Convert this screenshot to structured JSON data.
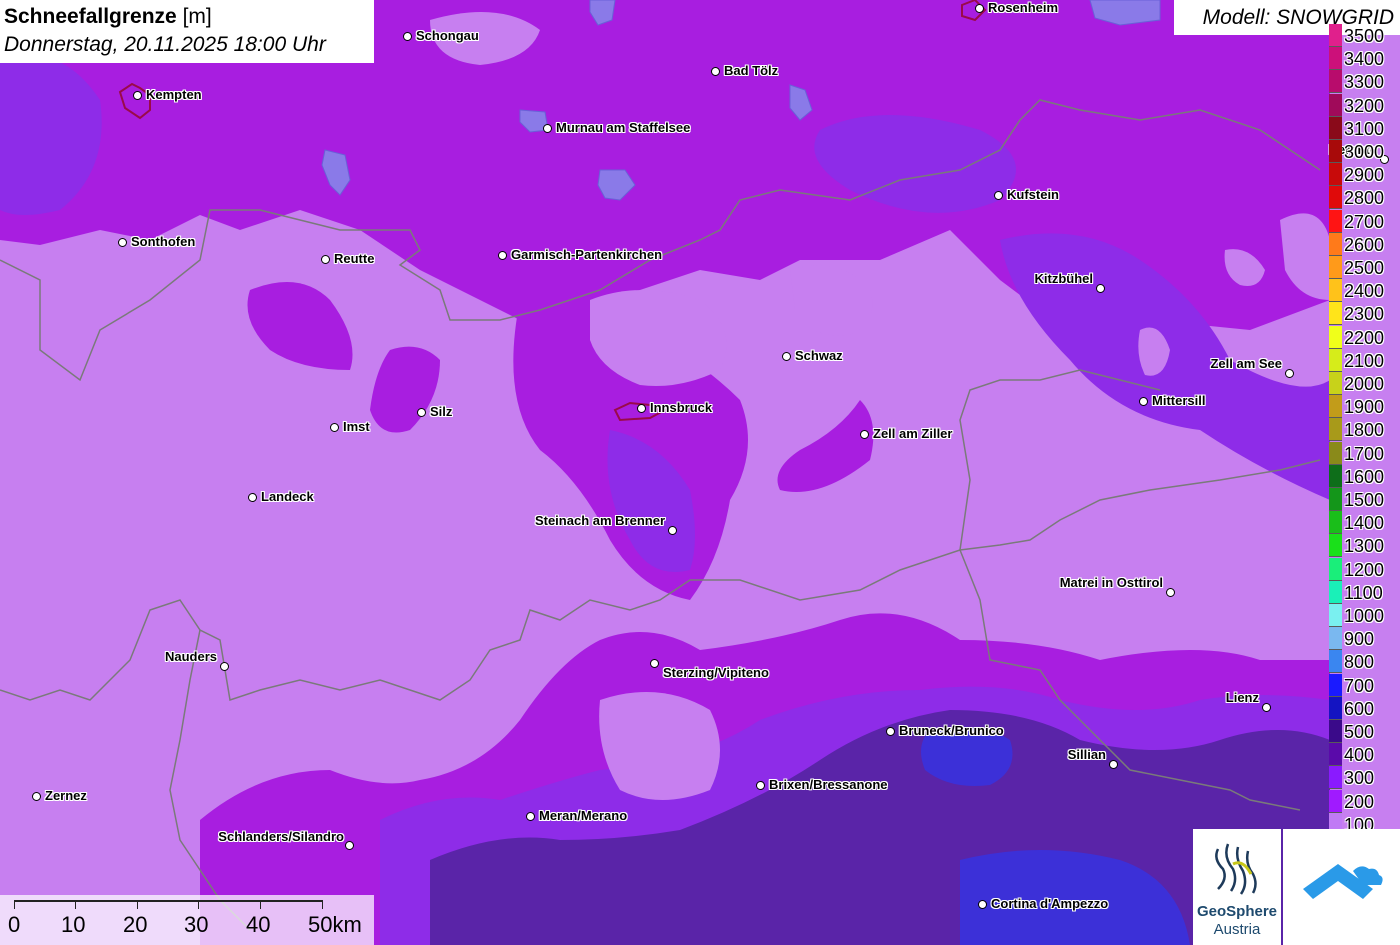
{
  "title": {
    "bold": "Schneefallgrenze",
    "unit": "[m]",
    "datetime": "Donnerstag, 20.11.2025 18:00 Uhr"
  },
  "model_label": "Modell: SNOWGRID",
  "cities": [
    {
      "name": "Rosenheim"
    },
    {
      "name": "Schongau"
    },
    {
      "name": "Bad Tölz"
    },
    {
      "name": "Kempten"
    },
    {
      "name": "Murnau am Staffelsee"
    },
    {
      "name": "Berchte"
    },
    {
      "name": "Kufstein"
    },
    {
      "name": "Sonthofen"
    },
    {
      "name": "Reutte"
    },
    {
      "name": "Garmisch-Partenkirchen"
    },
    {
      "name": "Kitzbühel"
    },
    {
      "name": "Schwaz"
    },
    {
      "name": "Zell am See"
    },
    {
      "name": "Mittersill"
    },
    {
      "name": "Innsbruck"
    },
    {
      "name": "Silz"
    },
    {
      "name": "Imst"
    },
    {
      "name": "Zell am Ziller"
    },
    {
      "name": "Landeck"
    },
    {
      "name": "Steinach am Brenner"
    },
    {
      "name": "Matrei in Osttirol"
    },
    {
      "name": "Nauders"
    },
    {
      "name": "Sterzing/Vipiteno"
    },
    {
      "name": "Lienz"
    },
    {
      "name": "Bruneck/Brunico"
    },
    {
      "name": "Sillian"
    },
    {
      "name": "Brixen/Bressanone"
    },
    {
      "name": "Zernez"
    },
    {
      "name": "Meran/Merano"
    },
    {
      "name": "Schlanders/Silandro"
    },
    {
      "name": "Cortina d'Ampezzo"
    }
  ],
  "legend": [
    {
      "value": "3500",
      "color": "#e0208c"
    },
    {
      "value": "3400",
      "color": "#cc107a"
    },
    {
      "value": "3300",
      "color": "#b80c6c"
    },
    {
      "value": "3200",
      "color": "#a00a5a"
    },
    {
      "value": "3100",
      "color": "#8a0a1a"
    },
    {
      "value": "3000",
      "color": "#a80a0a"
    },
    {
      "value": "2900",
      "color": "#c80a0a"
    },
    {
      "value": "2800",
      "color": "#e00a0a"
    },
    {
      "value": "2700",
      "color": "#ff1414"
    },
    {
      "value": "2600",
      "color": "#ff7a1a"
    },
    {
      "value": "2500",
      "color": "#ff9a1a"
    },
    {
      "value": "2400",
      "color": "#ffc21a"
    },
    {
      "value": "2300",
      "color": "#ffe41a"
    },
    {
      "value": "2200",
      "color": "#f0ff1a"
    },
    {
      "value": "2100",
      "color": "#d6ec1a"
    },
    {
      "value": "2000",
      "color": "#c8d21a"
    },
    {
      "value": "1900",
      "color": "#c29c1a"
    },
    {
      "value": "1800",
      "color": "#a89a1a"
    },
    {
      "value": "1700",
      "color": "#8a8a1a"
    },
    {
      "value": "1600",
      "color": "#0e6e1a"
    },
    {
      "value": "1500",
      "color": "#14961a"
    },
    {
      "value": "1400",
      "color": "#1abe1a"
    },
    {
      "value": "1300",
      "color": "#1ae01a"
    },
    {
      "value": "1200",
      "color": "#1aee7a"
    },
    {
      "value": "1100",
      "color": "#1af0b8"
    },
    {
      "value": "1000",
      "color": "#7af0f0"
    },
    {
      "value": "900",
      "color": "#7ab8f0"
    },
    {
      "value": "800",
      "color": "#3a86f0"
    },
    {
      "value": "700",
      "color": "#1a1aff"
    },
    {
      "value": "600",
      "color": "#1414c2"
    },
    {
      "value": "500",
      "color": "#3a0a8a"
    },
    {
      "value": "400",
      "color": "#5a0aaa"
    },
    {
      "value": "300",
      "color": "#8a1aff"
    },
    {
      "value": "200",
      "color": "#a01aff"
    },
    {
      "value": "100",
      "color": "#c07af5"
    }
  ],
  "scale": {
    "labels": [
      "0",
      "10",
      "20",
      "30",
      "40",
      "50km"
    ]
  },
  "logo": {
    "line1": "GeoSphere",
    "line2": "Austria"
  },
  "colors": {
    "base": "#c77ff0",
    "purple": "#a81ee0",
    "violet": "#8e2ce8",
    "dark": "#5a24a8",
    "blue": "#3c30d8",
    "border": "#7a7a7a"
  }
}
